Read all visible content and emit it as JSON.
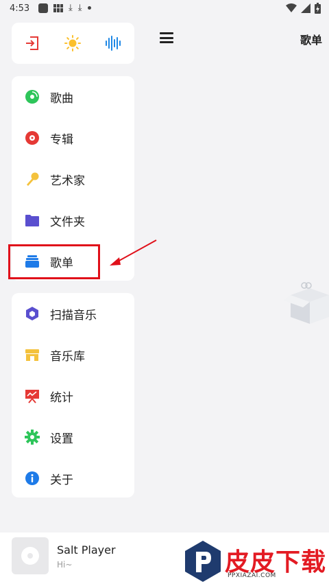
{
  "status_bar": {
    "time": "4:53"
  },
  "drawer": {
    "quick_actions": [
      {
        "icon": "exit-icon",
        "color": "#e53935"
      },
      {
        "icon": "sun-icon",
        "color": "#fbc02d"
      },
      {
        "icon": "waveform-icon",
        "color": "#1e88e5"
      }
    ],
    "library_items": [
      {
        "label": "歌曲",
        "icon": "disc-icon",
        "color": "#2ec55a"
      },
      {
        "label": "专辑",
        "icon": "record-icon",
        "color": "#e53935"
      },
      {
        "label": "艺术家",
        "icon": "microphone-icon",
        "color": "#f4c23d"
      },
      {
        "label": "文件夹",
        "icon": "folder-icon",
        "color": "#5a4fcf"
      },
      {
        "label": "歌单",
        "icon": "playlist-icon",
        "color": "#1e7be8"
      }
    ],
    "tool_items": [
      {
        "label": "扫描音乐",
        "icon": "scan-icon",
        "color": "#5a4fcf"
      },
      {
        "label": "音乐库",
        "icon": "store-icon",
        "color": "#f4c23d"
      },
      {
        "label": "统计",
        "icon": "stats-icon",
        "color": "#e53935"
      },
      {
        "label": "设置",
        "icon": "gear-icon",
        "color": "#2ec55a"
      },
      {
        "label": "关于",
        "icon": "info-icon",
        "color": "#1e7be8"
      }
    ]
  },
  "main": {
    "title": "歌单"
  },
  "player": {
    "title": "Salt Player",
    "subtitle": "Hi~"
  },
  "watermark": {
    "text": "皮皮下载",
    "url": "PPXIAZAI.COM"
  }
}
